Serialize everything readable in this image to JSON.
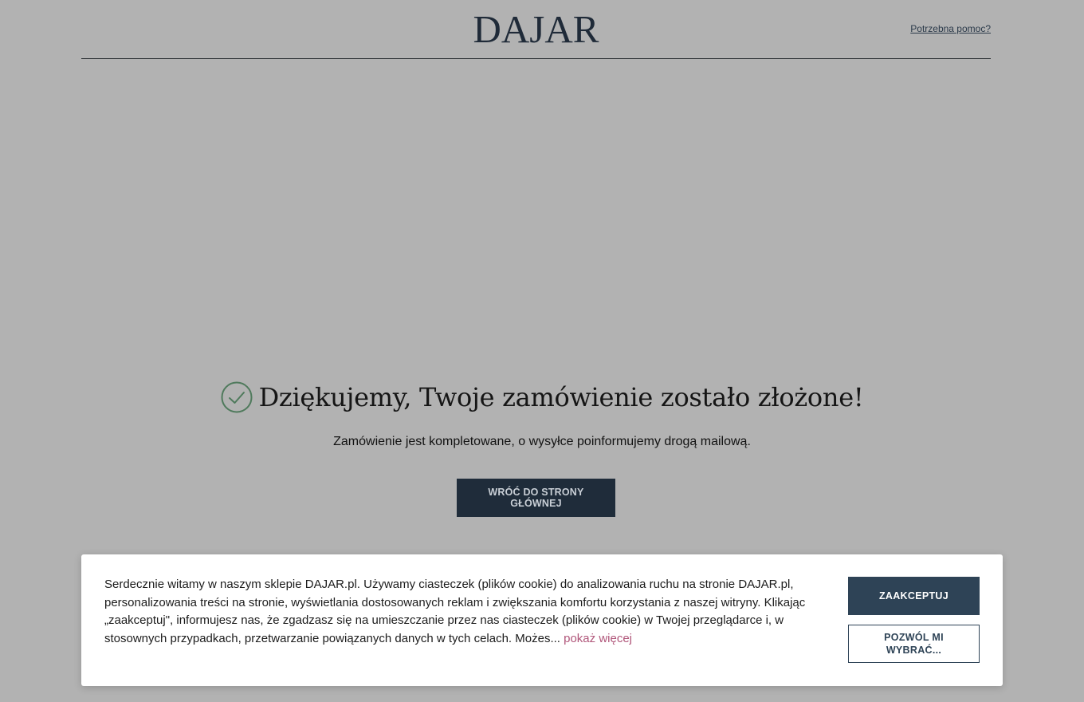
{
  "header": {
    "logo": "DAJAR",
    "help_link": "Potrzebna pomoc?"
  },
  "confirmation": {
    "title": "Dziękujemy, Twoje zamówienie zostało złożone!",
    "subtitle": "Zamówienie jest kompletowane, o wysyłce poinformujemy drogą mailową.",
    "home_button": "WRÓĆ DO STRONY GŁÓWNEJ",
    "check_icon": "check-circle-icon"
  },
  "cookie_banner": {
    "text": "Serdecznie witamy w naszym sklepie DAJAR.pl. Używamy ciasteczek (plików cookie) do analizowania ruchu na stronie DAJAR.pl, personalizowania treści na stronie, wyświetlania dostosowanych reklam i zwiększania komfortu korzystania z naszej witryny. Klikając „zaakceptuj\", informujesz nas, że zgadzasz się na umieszczanie przez nas ciasteczek (plików cookie) w Twojej przeglądarce i, w stosownych przypadkach, przetwarzanie powiązanych danych w tych celach. Możes...",
    "show_more": "pokaż więcej",
    "accept_button": "ZAAKCEPTUJ",
    "choose_button": "POZWÓL MI WYBRAĆ..."
  },
  "colors": {
    "backdrop": "#b2b2b2",
    "primary_dark": "#1f2c3a",
    "accept_bg": "#2e4356",
    "link_pink": "#b0567a",
    "check_green": "#4f7a5c"
  }
}
